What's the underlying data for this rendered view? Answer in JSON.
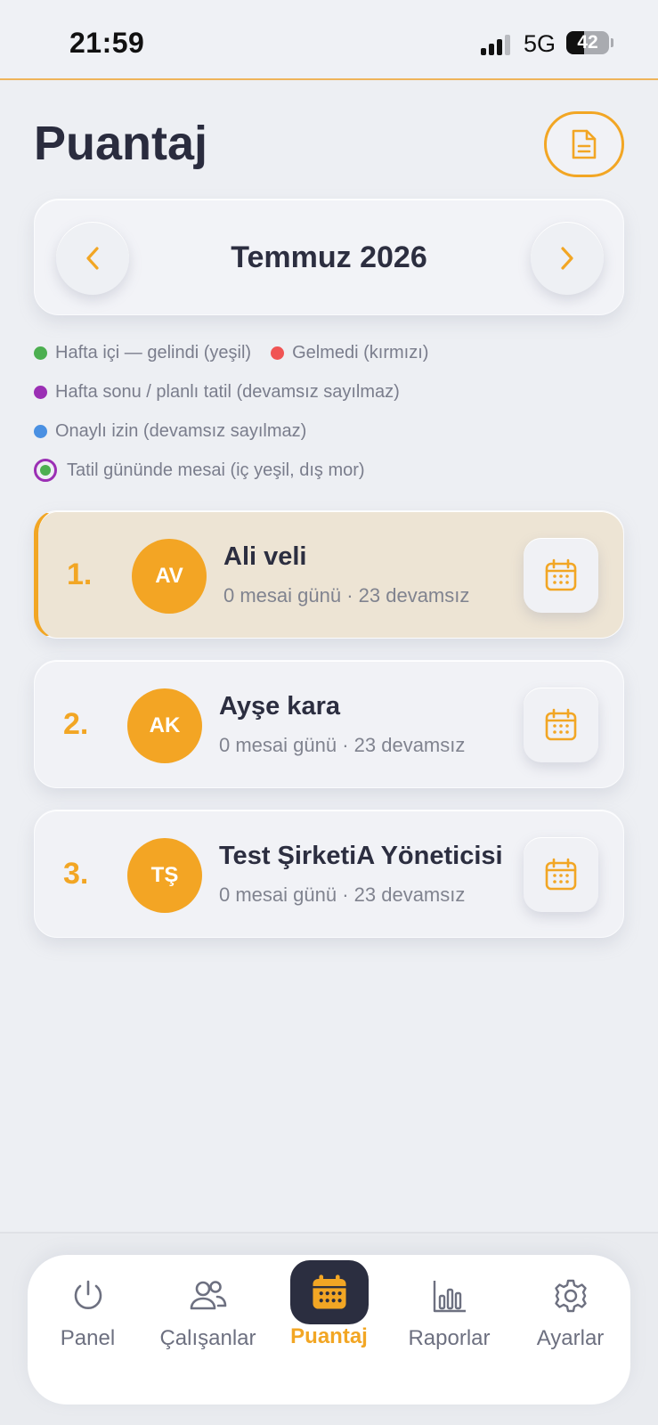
{
  "status_bar": {
    "time": "21:59",
    "network": "5G",
    "battery": "42",
    "battery_level": 0.42
  },
  "header": {
    "title": "Puantaj",
    "report_icon": "document-icon"
  },
  "month_nav": {
    "label": "Temmuz 2026",
    "prev_icon": "chevron-left-icon",
    "next_icon": "chevron-right-icon"
  },
  "legend": [
    {
      "label": "Hafta içi — gelindi (yeşil)",
      "color": "#4caf50"
    },
    {
      "label": "Gelmedi (kırmızı)",
      "color": "#f05454"
    },
    {
      "label": "Hafta sonu / planlı tatil (devamsız sayılmaz)",
      "color": "#9b2fb4"
    },
    {
      "label": "Onaylı izin (devamsız sayılmaz)",
      "color": "#4a90e2"
    },
    {
      "label": "Tatil gününde mesai (iç yeşil, dış mor)",
      "inner_color": "#4caf50",
      "outer_color": "#9b2fb4"
    }
  ],
  "employees": [
    {
      "rank": "1.",
      "initials": "AV",
      "name": "Ali veli",
      "meta": "0 mesai günü · 23 devamsız",
      "selected": true
    },
    {
      "rank": "2.",
      "initials": "AK",
      "name": "Ayşe kara",
      "meta": "0 mesai günü · 23 devamsız",
      "selected": false
    },
    {
      "rank": "3.",
      "initials": "TŞ",
      "name": "Test ŞirketiA Yöneticisi",
      "meta": "0 mesai günü · 23 devamsız",
      "selected": false
    }
  ],
  "tabs": [
    {
      "label": "Panel",
      "icon": "power-icon"
    },
    {
      "label": "Çalışanlar",
      "icon": "users-icon"
    },
    {
      "label": "Puantaj",
      "icon": "calendar-icon",
      "active": true
    },
    {
      "label": "Raporlar",
      "icon": "bar-chart-icon"
    },
    {
      "label": "Ayarlar",
      "icon": "gear-icon"
    }
  ],
  "colors": {
    "accent": "#f2a624",
    "dark": "#2b2e40",
    "background": "#edeff3"
  }
}
